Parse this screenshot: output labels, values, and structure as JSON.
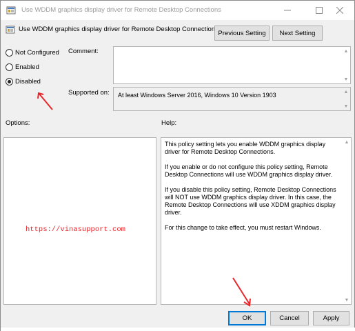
{
  "window": {
    "title": "Use WDDM graphics display driver for Remote Desktop Connections",
    "minimize_icon": "minimize-icon",
    "maximize_icon": "maximize-icon",
    "close_icon": "close-icon"
  },
  "header": {
    "policy_name": "Use WDDM graphics display driver for Remote Desktop Connections",
    "previous_label": "Previous Setting",
    "next_label": "Next Setting"
  },
  "state": {
    "options": [
      {
        "label": "Not Configured",
        "selected": false
      },
      {
        "label": "Enabled",
        "selected": false
      },
      {
        "label": "Disabled",
        "selected": true
      }
    ]
  },
  "comment": {
    "label": "Comment:",
    "value": ""
  },
  "supported": {
    "label": "Supported on:",
    "value": "At least Windows Server 2016, Windows 10 Version 1903"
  },
  "options_section": {
    "label": "Options:"
  },
  "help_section": {
    "label": "Help:",
    "paragraphs": [
      "This policy setting lets you enable WDDM graphics display driver for Remote Desktop Connections.",
      "If you enable or do not configure this policy setting, Remote Desktop Connections will use WDDM graphics display driver.",
      "If you disable this policy setting, Remote Desktop Connections will NOT use WDDM graphics display driver. In this case, the Remote Desktop Connections will use XDDM graphics display driver.",
      "For this change to take effect, you must restart Windows."
    ]
  },
  "watermark": {
    "text": "https://vinasupport.com"
  },
  "footer": {
    "ok_label": "OK",
    "cancel_label": "Cancel",
    "apply_label": "Apply"
  },
  "colors": {
    "annotation": "#e8252a",
    "focus": "#0078d7"
  }
}
